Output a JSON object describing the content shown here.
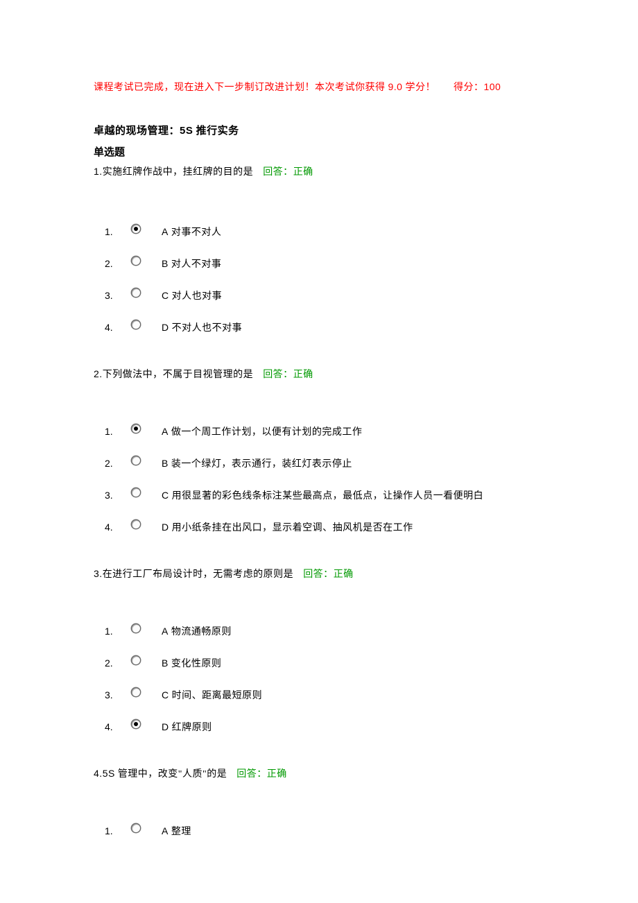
{
  "notice": {
    "left": "课程考试已完成，现在进入下一步制订改进计划！本次考试你获得 ",
    "credits": "9.0",
    "left_after": " 学分！",
    "right_label": "得分：",
    "score": "100"
  },
  "title_prefix": "卓越的现场管理：",
  "title_latin": "5S",
  "title_suffix": " 推行实务",
  "section_type": "单选题",
  "answer_label_prefix": "回答：",
  "answer_label_value": "正确",
  "questions": [
    {
      "num": "1.",
      "stem": "实施红牌作战中，挂红牌的目的是",
      "selected": 0,
      "options": [
        {
          "n": "1.",
          "letter": "A",
          "text": "对事不对人"
        },
        {
          "n": "2.",
          "letter": "B",
          "text": "对人不对事"
        },
        {
          "n": "3.",
          "letter": "C",
          "text": "对人也对事"
        },
        {
          "n": "4.",
          "letter": "D",
          "text": "不对人也不对事"
        }
      ]
    },
    {
      "num": "2.",
      "stem": "下列做法中，不属于目视管理的是",
      "selected": 0,
      "options": [
        {
          "n": "1.",
          "letter": "A",
          "text": "做一个周工作计划，以便有计划的完成工作"
        },
        {
          "n": "2.",
          "letter": "B",
          "text": "装一个绿灯，表示通行，装红灯表示停止"
        },
        {
          "n": "3.",
          "letter": "C",
          "text": "用很显著的彩色线条标注某些最高点，最低点，让操作人员一看便明白"
        },
        {
          "n": "4.",
          "letter": "D",
          "text": "用小纸条挂在出风口，显示着空调、抽风机是否在工作"
        }
      ]
    },
    {
      "num": "3.",
      "stem": "在进行工厂布局设计时，无需考虑的原则是",
      "selected": 3,
      "options": [
        {
          "n": "1.",
          "letter": "A",
          "text": "物流通畅原则"
        },
        {
          "n": "2.",
          "letter": "B",
          "text": "变化性原则"
        },
        {
          "n": "3.",
          "letter": "C",
          "text": "时间、距离最短原则"
        },
        {
          "n": "4.",
          "letter": "D",
          "text": "红牌原则"
        }
      ]
    },
    {
      "num": "4.",
      "stem_prefix": "5S",
      "stem": " 管理中，改变\"人质\"的是",
      "selected": -1,
      "options": [
        {
          "n": "1.",
          "letter": "A",
          "text": "整理"
        }
      ]
    }
  ]
}
